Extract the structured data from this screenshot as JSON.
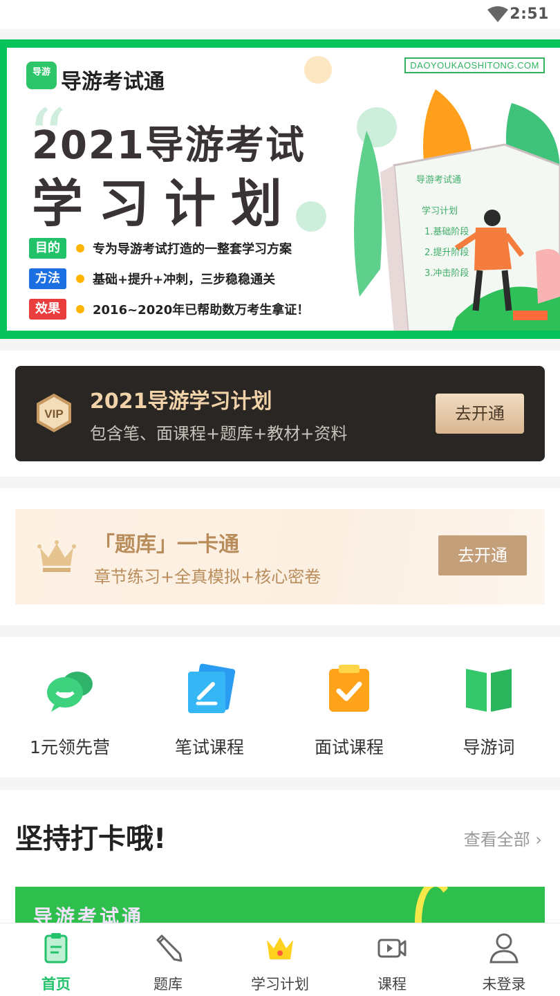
{
  "status_bar": {
    "time": "2:51",
    "wifi_icon": "wifi-icon"
  },
  "banner": {
    "logo_badge": "导游",
    "logo_text": "导游考试通",
    "domain": "DAOYOUKAOSHITONG.COM",
    "title_line1": "2021导游考试",
    "title_line2": "学习计划",
    "rows": [
      {
        "tag": "目的",
        "tag_color": "#22c26a",
        "text": "专为导游考试打造的一整套学习方案"
      },
      {
        "tag": "方法",
        "tag_color": "#1c6fe0",
        "text": "基础+提升+冲刺，三步稳稳通关"
      },
      {
        "tag": "效果",
        "tag_color": "#ea3d3d",
        "text": "2016~2020年已帮助数万考生拿证！"
      }
    ],
    "art_lines": [
      "导游考试通",
      "学习计划",
      "1.基础阶段",
      "2.提升阶段",
      "3.冲击阶段"
    ],
    "colors": {
      "frame": "#05c25a",
      "accent": "#ffb400"
    }
  },
  "vip_card": {
    "badge": "VIP",
    "title": "2021导游学习计划",
    "subtitle": "包含笔、面课程+题库+教材+资料",
    "button": "去开通"
  },
  "tiku_card": {
    "title": "「题库」一卡通",
    "subtitle": "章节练习+全真模拟+核心密卷",
    "button": "去开通"
  },
  "quick_entries": [
    {
      "label": "1元领先营",
      "icon": "chat-bubble-icon"
    },
    {
      "label": "笔试课程",
      "icon": "pen-card-icon"
    },
    {
      "label": "面试课程",
      "icon": "clipboard-check-icon"
    },
    {
      "label": "导游词",
      "icon": "open-book-icon"
    }
  ],
  "checkin": {
    "title": "坚持打卡哦!",
    "more": "查看全部 ›",
    "strip_text": "导游考试通"
  },
  "tabbar": {
    "active": "首页",
    "tabs": [
      {
        "label": "首页",
        "icon": "clipboard-home-icon"
      },
      {
        "label": "题库",
        "icon": "pencil-icon"
      },
      {
        "label": "学习计划",
        "icon": "crown-icon"
      },
      {
        "label": "课程",
        "icon": "video-icon"
      },
      {
        "label": "未登录",
        "icon": "user-icon"
      }
    ]
  }
}
